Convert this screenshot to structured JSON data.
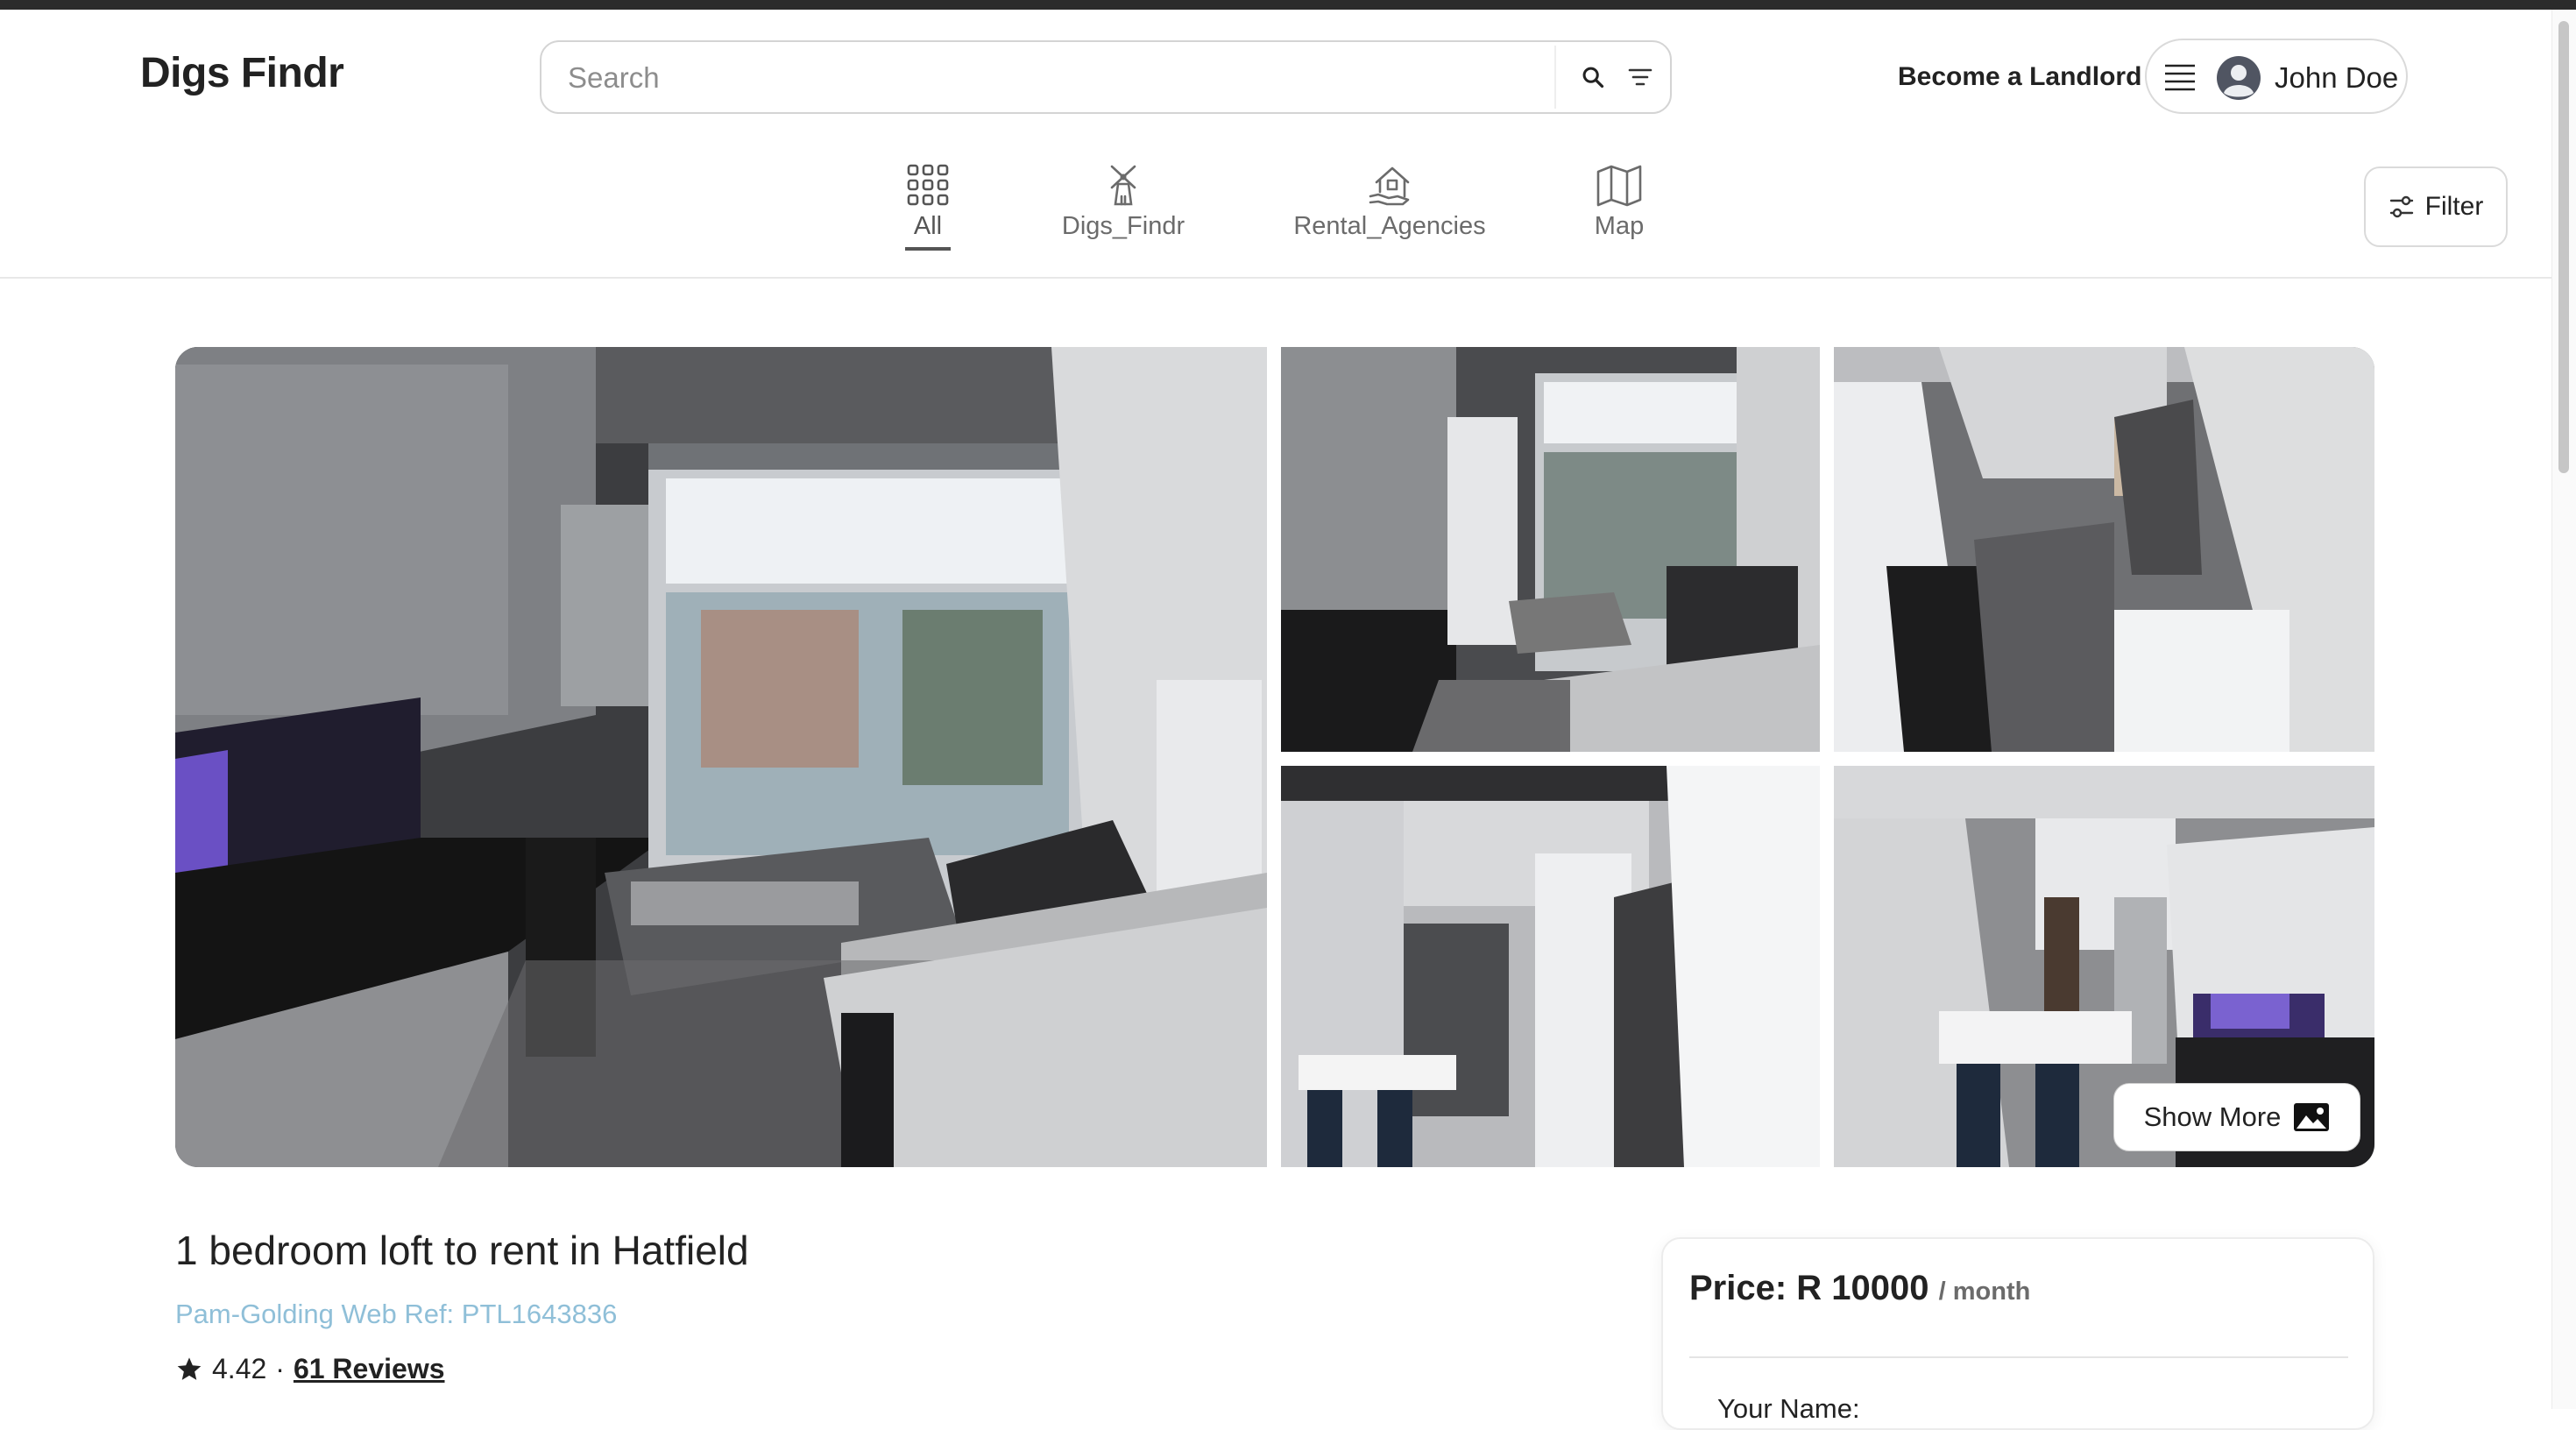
{
  "brand": "Digs Findr",
  "search": {
    "placeholder": "Search"
  },
  "header": {
    "become_landlord": "Become a Landlord",
    "user_name": "John Doe"
  },
  "categories": [
    {
      "label": "All",
      "icon": "grid-icon",
      "active": true
    },
    {
      "label": "Digs_Findr",
      "icon": "windmill-icon",
      "active": false
    },
    {
      "label": "Rental_Agencies",
      "icon": "house-hand-icon",
      "active": false
    },
    {
      "label": "Map",
      "icon": "map-icon",
      "active": false
    }
  ],
  "filter_label": "Filter",
  "gallery": {
    "show_more_label": "Show More"
  },
  "listing": {
    "title": "1 bedroom loft to rent in Hatfield",
    "reference": "Pam-Golding Web Ref: PTL1643836",
    "rating": "4.42",
    "rating_separator": "·",
    "reviews": "61 Reviews"
  },
  "booking": {
    "price_label": "Price: R 10000",
    "price_unit": "/ month",
    "name_label": "Your Name:"
  },
  "colors": {
    "reference_link": "#8fbfd8",
    "text": "#222222",
    "muted": "#6b6b6b"
  }
}
